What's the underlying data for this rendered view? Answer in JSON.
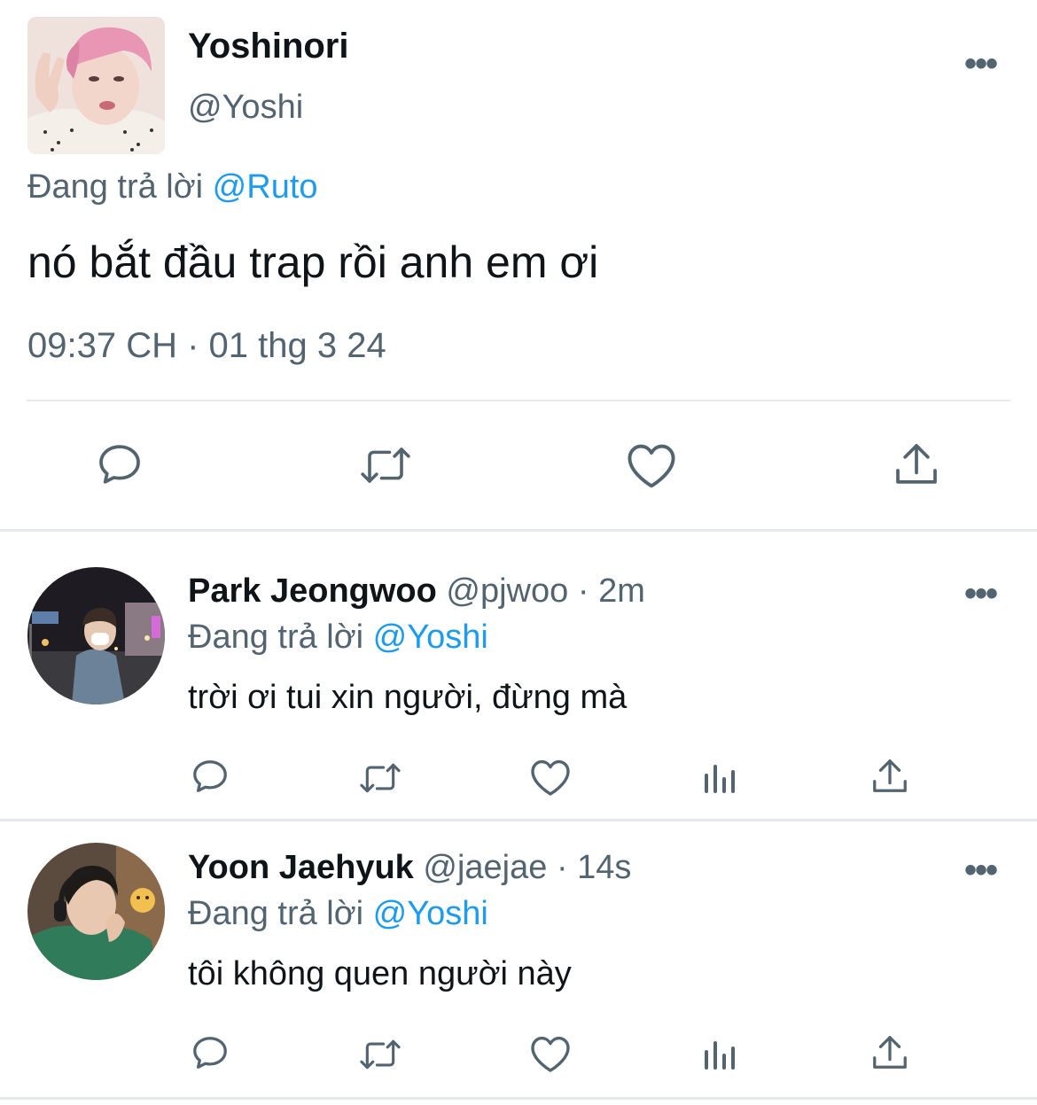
{
  "main_tweet": {
    "display_name": "Yoshinori",
    "handle": "@Yoshi",
    "replying_prefix": "Đang trả lời",
    "replying_to": "@Ruto",
    "text": "nó bắt đầu trap rồi anh em ơi",
    "timestamp": "09:37 CH · 01 thg 3 24",
    "more_label": "•••"
  },
  "replies": [
    {
      "display_name": "Park Jeongwoo",
      "handle": "@pjwoo",
      "separator": "·",
      "time": "2m",
      "replying_prefix": "Đang trả lời",
      "replying_to": "@Yoshi",
      "text": "trời ơi tui xin người, đừng mà",
      "more_label": "•••"
    },
    {
      "display_name": "Yoon Jaehyuk",
      "handle": "@jaejae",
      "separator": "·",
      "time": "14s",
      "replying_prefix": "Đang trả lời",
      "replying_to": "@Yoshi",
      "text": "tôi không quen người này",
      "more_label": "•••"
    }
  ],
  "icons": {
    "reply": "speech-bubble-icon",
    "retweet": "retweet-icon",
    "like": "heart-icon",
    "views": "bar-chart-icon",
    "share": "share-upload-icon"
  },
  "colors": {
    "text": "#0f1419",
    "secondary": "#536471",
    "link": "#1d9bf0",
    "divider": "#e6e9ec"
  }
}
